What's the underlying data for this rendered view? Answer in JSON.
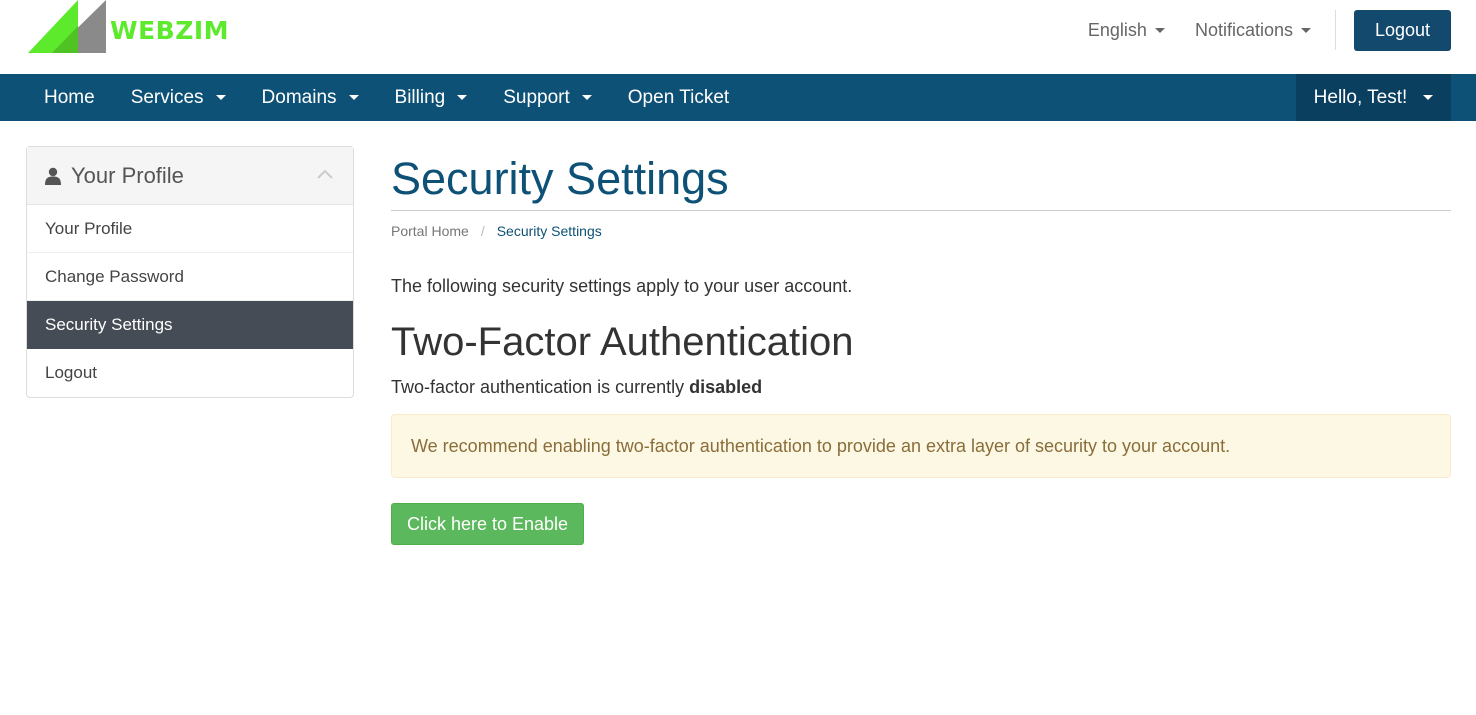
{
  "brand": {
    "logo_text": "WEBZIM",
    "accent": "#5eea2c",
    "primary": "#0e5177"
  },
  "topbar": {
    "language_label": "English",
    "notifications_label": "Notifications",
    "logout_label": "Logout"
  },
  "nav": {
    "items": [
      {
        "label": "Home",
        "has_dropdown": false
      },
      {
        "label": "Services",
        "has_dropdown": true
      },
      {
        "label": "Domains",
        "has_dropdown": true
      },
      {
        "label": "Billing",
        "has_dropdown": true
      },
      {
        "label": "Support",
        "has_dropdown": true
      },
      {
        "label": "Open Ticket",
        "has_dropdown": false
      }
    ],
    "user_label": "Hello, Test!"
  },
  "sidebar": {
    "title": "Your Profile",
    "title_icon": "user-icon",
    "items": [
      {
        "label": "Your Profile",
        "active": false
      },
      {
        "label": "Change Password",
        "active": false
      },
      {
        "label": "Security Settings",
        "active": true
      },
      {
        "label": "Logout",
        "active": false
      }
    ]
  },
  "main": {
    "page_title": "Security Settings",
    "breadcrumb": {
      "home": "Portal Home",
      "separator": "/",
      "current": "Security Settings"
    },
    "intro": "The following security settings apply to your user account.",
    "section_title": "Two-Factor Authentication",
    "status_prefix": "Two-factor authentication is currently",
    "status_value": "disabled",
    "alert": "We recommend enabling two-factor authentication to provide an extra layer of security to your account.",
    "enable_button": "Click here to Enable"
  }
}
